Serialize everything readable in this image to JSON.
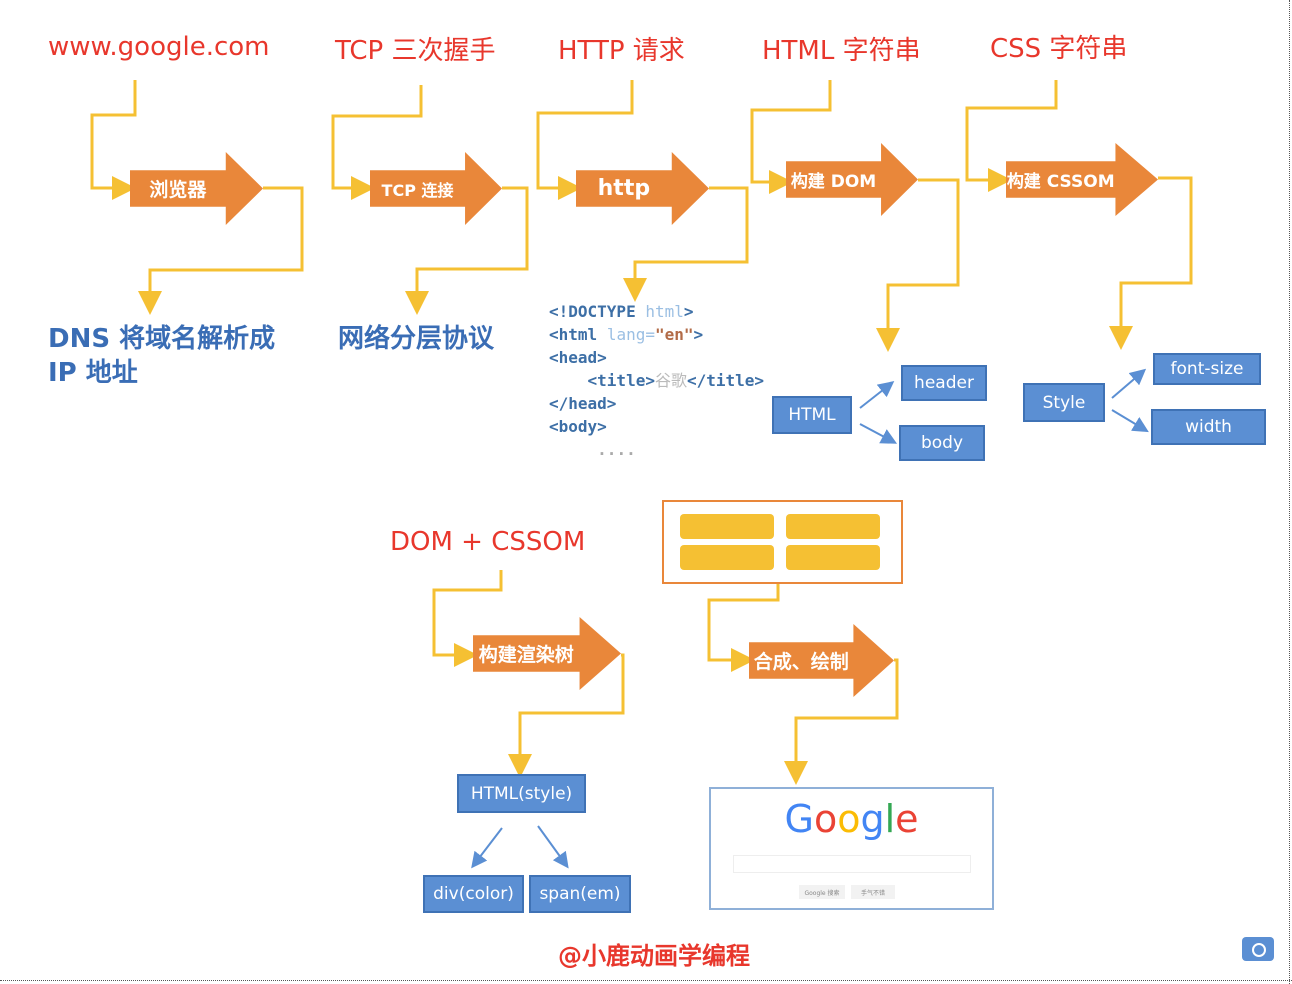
{
  "top_labels": [
    "www.google.com",
    "TCP 三次握手",
    "HTTP 请求",
    "HTML 字符串",
    "CSS 字符串"
  ],
  "arrows": [
    "浏览器",
    "TCP 连接",
    "http",
    "构建 DOM",
    "构建 CSSOM",
    "构建渲染树",
    "合成、绘制"
  ],
  "bottom_labels": {
    "dns": "DNS 将域名解析成 IP 地址",
    "network": "网络分层协议"
  },
  "code": {
    "doctype": "<!DOCTYPE",
    "doctype_attr": "html",
    "close": ">",
    "html_open": "<html",
    "lang_attr": "lang=",
    "lang_val": "\"en\"",
    "head_open": "<head>",
    "title_open": "<title>",
    "title_text": "谷歌",
    "title_close": "</title>",
    "head_close": "</head>",
    "body_open": "<body>",
    "ellipsis": "...."
  },
  "dom_tree": {
    "root": "HTML",
    "children": [
      "header",
      "body"
    ]
  },
  "cssom_tree": {
    "root": "Style",
    "children": [
      "font-size",
      "width"
    ]
  },
  "mid_label": "DOM + CSSOM",
  "render_tree": {
    "root": "HTML(style)",
    "children": [
      "div(color)",
      "span(em)"
    ]
  },
  "google": {
    "logo": [
      "G",
      "o",
      "o",
      "g",
      "l",
      "e"
    ],
    "logo_colors": [
      "#4285f4",
      "#ea4335",
      "#fbbc05",
      "#4285f4",
      "#34a853",
      "#ea4335"
    ],
    "buttons": [
      "Google 搜索",
      "手气不错"
    ]
  },
  "watermark": "@小鹿动画学编程",
  "colors": {
    "label_red": "#e8372c",
    "arrow_orange": "#e9873a",
    "connector_yellow": "#f5c033",
    "box_blue": "#5b8fd3"
  },
  "icons": {
    "corner": "camera-icon"
  }
}
